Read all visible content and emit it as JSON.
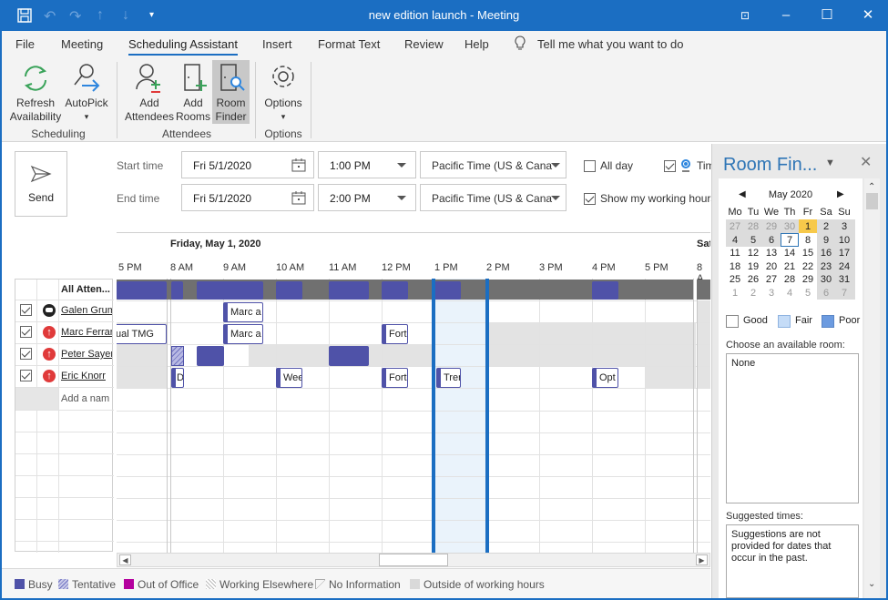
{
  "window": {
    "title": "new edition launch  -  Meeting",
    "controls": [
      "restore-ribbon",
      "minimize",
      "maximize",
      "close"
    ]
  },
  "menu": {
    "tabs": [
      {
        "label": "File"
      },
      {
        "label": "Meeting"
      },
      {
        "label": "Scheduling Assistant",
        "active": true
      },
      {
        "label": "Insert"
      },
      {
        "label": "Format Text"
      },
      {
        "label": "Review"
      },
      {
        "label": "Help"
      }
    ],
    "tell_me": "Tell me what you want to do"
  },
  "ribbon": {
    "refresh": {
      "line1": "Refresh",
      "line2": "Availability"
    },
    "autopick": {
      "line1": "AutoPick",
      "line2": "▾"
    },
    "add_attendees": {
      "line1": "Add",
      "line2": "Attendees"
    },
    "add_rooms": {
      "line1": "Add",
      "line2": "Rooms"
    },
    "room_finder": {
      "line1": "Room",
      "line2": "Finder"
    },
    "options": {
      "line1": "Options",
      "line2": "▾"
    },
    "groups": {
      "scheduling": "Scheduling",
      "attendees": "Attendees",
      "options": "Options"
    }
  },
  "form": {
    "send": "Send",
    "start_label": "Start time",
    "end_label": "End time",
    "start_date": "Fri 5/1/2020",
    "end_date": "Fri 5/1/2020",
    "start_time": "1:00 PM",
    "end_time": "2:00 PM",
    "start_tz": "Pacific Time (US & Cana",
    "end_tz": "Pacific Time (US & Cana",
    "all_day": {
      "label": "All day",
      "checked": false
    },
    "time_zones": {
      "label": "Tim",
      "checked": true
    },
    "working_hours": {
      "label": "Show my working hours",
      "checked": true
    }
  },
  "schedule": {
    "date_header": "Friday, May 1, 2020",
    "next_day_header": "Sat",
    "time_labels": [
      "5 PM",
      "8 AM",
      "9 AM",
      "10 AM",
      "11 AM",
      "12 PM",
      "1 PM",
      "2 PM",
      "3 PM",
      "4 PM",
      "5 PM",
      "8 A"
    ],
    "all_attendees": "All Atten...",
    "add_name_placeholder": "Add a nam",
    "attendees": [
      {
        "name": "Galen Grum",
        "checked": true,
        "status": "organizer"
      },
      {
        "name": "Marc Ferrar",
        "checked": true,
        "status": "required"
      },
      {
        "name": "Peter Sayer",
        "checked": true,
        "status": "required"
      },
      {
        "name": "Eric Knorr",
        "checked": true,
        "status": "required"
      }
    ],
    "appointments": {
      "galen_1": "Marc a",
      "marc_0": "ual TMG",
      "marc_1": "Marc a",
      "marc_2": "Fort",
      "eric_0": "D",
      "eric_1": "Wee",
      "eric_2": "Fort",
      "eric_3": "Trer",
      "eric_4": "Opt"
    }
  },
  "legend": {
    "busy": "Busy",
    "tentative": "Tentative",
    "out_of_office": "Out of Office",
    "working_elsewhere": "Working Elsewhere",
    "no_information": "No Information",
    "outside_hours": "Outside of working hours",
    "colors": {
      "busy": "#4f52a8",
      "tentative": "#9ea0d6",
      "out_of_office": "#b4009e",
      "outside": "#d9d9d9"
    }
  },
  "room_finder": {
    "title": "Room Fin...",
    "month": "May 2020",
    "weekdays": [
      "Mo",
      "Tu",
      "We",
      "Th",
      "Fr",
      "Sa",
      "Su"
    ],
    "weeks": [
      [
        "27",
        "28",
        "29",
        "30",
        "1",
        "2",
        "3"
      ],
      [
        "4",
        "5",
        "6",
        "7",
        "8",
        "9",
        "10"
      ],
      [
        "11",
        "12",
        "13",
        "14",
        "15",
        "16",
        "17"
      ],
      [
        "18",
        "19",
        "20",
        "21",
        "22",
        "23",
        "24"
      ],
      [
        "25",
        "26",
        "27",
        "28",
        "29",
        "30",
        "31"
      ],
      [
        "1",
        "2",
        "3",
        "4",
        "5",
        "6",
        "7"
      ]
    ],
    "selected_day": "1",
    "today": "7",
    "quality": {
      "good": "Good",
      "fair": "Fair",
      "poor": "Poor"
    },
    "choose_room_label": "Choose an available room:",
    "rooms": [
      "None"
    ],
    "suggested_label": "Suggested times:",
    "suggested_text": "Suggestions are not provided for dates that occur in the past."
  }
}
